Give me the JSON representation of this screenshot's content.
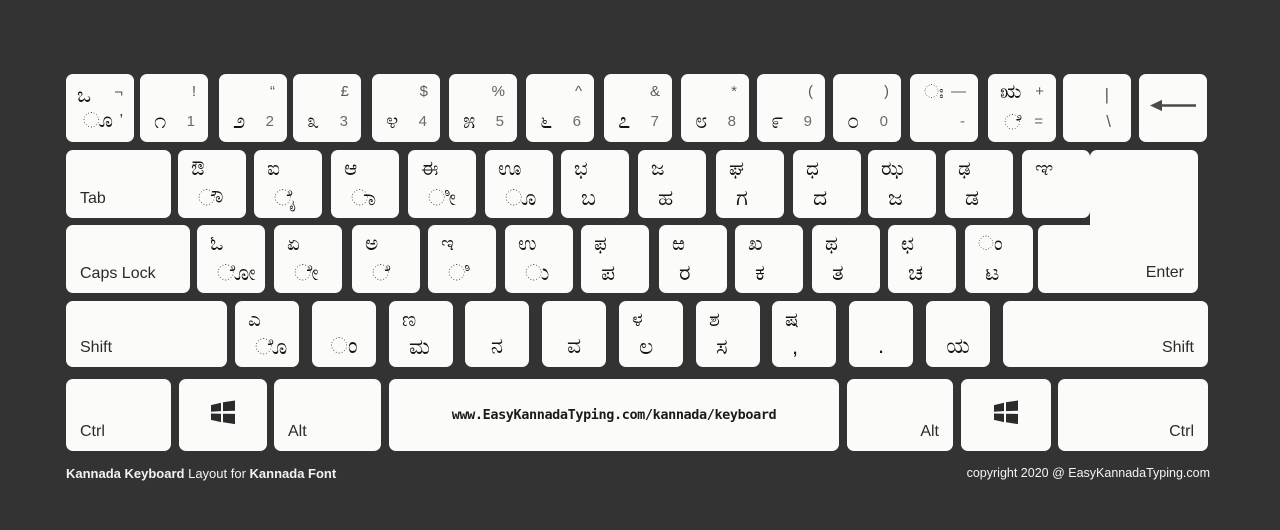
{
  "page": {
    "background_color": "#333333",
    "key_color": "#fbfbf9",
    "key_text_color": "#1c1c1c",
    "symbol_text_color": "#5c5c5c"
  },
  "footer": {
    "left_bold_1": "Kannada Keyboard",
    "left_regular": " Layout for ",
    "left_bold_2": "Kannada Font",
    "right": "copyright 2020 @ EasyKannadaTyping.com"
  },
  "spacebar": {
    "url": "www.EasyKannadaTyping.com/kannada/keyboard"
  },
  "rows": {
    "number_row": [
      {
        "name": "backquote",
        "tl": "ಒ",
        "tr": "¬",
        "bl": "ೂ",
        "br": "’"
      },
      {
        "name": "digit-1",
        "symbol": "!",
        "kannada": "೧",
        "digit": "1"
      },
      {
        "name": "digit-2",
        "symbol": "“",
        "kannada": "೨",
        "digit": "2"
      },
      {
        "name": "digit-3",
        "symbol": "£",
        "kannada": "೩",
        "digit": "3"
      },
      {
        "name": "digit-4",
        "symbol": "$",
        "kannada": "೪",
        "digit": "4"
      },
      {
        "name": "digit-5",
        "symbol": "%",
        "kannada": "೫",
        "digit": "5"
      },
      {
        "name": "digit-6",
        "symbol": "^",
        "kannada": "೬",
        "digit": "6"
      },
      {
        "name": "digit-7",
        "symbol": "&",
        "kannada": "೭",
        "digit": "7"
      },
      {
        "name": "digit-8",
        "symbol": "*",
        "kannada": "೮",
        "digit": "8"
      },
      {
        "name": "digit-9",
        "symbol": "(",
        "kannada": "೯",
        "digit": "9"
      },
      {
        "name": "digit-0",
        "symbol": ")",
        "kannada": "೦",
        "digit": "0"
      },
      {
        "name": "minus",
        "upper": "ಃ",
        "upper_sym": "—",
        "lower_sym": "-"
      },
      {
        "name": "equal",
        "upper": "ಋ",
        "upper_sym": "+",
        "lower": "ೆ",
        "lower_sym": "="
      },
      {
        "name": "backslash",
        "pipe": "|",
        "backslash": "\\"
      },
      {
        "name": "backspace",
        "icon": "backspace-arrow-icon"
      }
    ],
    "tab_row": {
      "tab_label": "Tab",
      "keys": [
        {
          "name": "key-q",
          "upper": "ಔ",
          "lower": "ೌ"
        },
        {
          "name": "key-w",
          "upper": "ಐ",
          "lower": "ೈ"
        },
        {
          "name": "key-e",
          "upper": "ಆ",
          "lower": "ಾ"
        },
        {
          "name": "key-r",
          "upper": "ಈ",
          "lower": "ೀ"
        },
        {
          "name": "key-t",
          "upper": "ಊ",
          "lower": "ೂ"
        },
        {
          "name": "key-y",
          "upper": "ಭ",
          "lower": "ಬ"
        },
        {
          "name": "key-u",
          "upper": "ಜ",
          "lower": "ಹ"
        },
        {
          "name": "key-i",
          "upper": "ಘ",
          "lower": "ಗ"
        },
        {
          "name": "key-o",
          "upper": "ಧ",
          "lower": "ದ"
        },
        {
          "name": "key-p",
          "upper": "ಝ",
          "lower": "ಜ"
        },
        {
          "name": "key-bracketleft",
          "upper": "ಢ",
          "lower": "ಡ"
        },
        {
          "name": "key-bracketright",
          "upper": "ಞ"
        }
      ]
    },
    "caps_row": {
      "caps_label": "Caps Lock",
      "enter_label": "Enter",
      "keys": [
        {
          "name": "key-a",
          "upper": "ಓ",
          "lower": "ೋ"
        },
        {
          "name": "key-s",
          "upper": "ಏ",
          "lower": "ೇ"
        },
        {
          "name": "key-d",
          "upper": "ಅ",
          "lower": "ೆ"
        },
        {
          "name": "key-f",
          "upper": "ಇ",
          "lower": "ಿ"
        },
        {
          "name": "key-g",
          "upper": "ಉ",
          "lower": "ು"
        },
        {
          "name": "key-h",
          "upper": "ಫ",
          "lower": "ಪ"
        },
        {
          "name": "key-j",
          "upper": "ಱ",
          "lower": "ರ"
        },
        {
          "name": "key-k",
          "upper": "ಖ",
          "lower": "ಕ"
        },
        {
          "name": "key-l",
          "upper": "ಥ",
          "lower": "ತ"
        },
        {
          "name": "key-semicolon",
          "upper": "ಛ",
          "lower": "ಚ"
        },
        {
          "name": "key-quote",
          "upper": "ಂ",
          "lower": "ಟ"
        }
      ]
    },
    "shift_row": {
      "shift_left_label": "Shift",
      "shift_right_label": "Shift",
      "keys": [
        {
          "name": "key-z",
          "upper": "ಎ",
          "lower": "ೊ"
        },
        {
          "name": "key-x",
          "lower_only": "ಂ"
        },
        {
          "name": "key-c",
          "upper": "ಣ",
          "lower": "ಮ"
        },
        {
          "name": "key-v",
          "lower_only": "ನ"
        },
        {
          "name": "key-b",
          "lower_only": "ವ"
        },
        {
          "name": "key-n",
          "upper": "ಳ",
          "lower": "ಲ"
        },
        {
          "name": "key-m",
          "upper": "ಶ",
          "lower": "ಸ"
        },
        {
          "name": "key-comma",
          "upper": "ಷ",
          "lower": ","
        },
        {
          "name": "key-period",
          "lower_only": "."
        },
        {
          "name": "key-slash",
          "lower_only": "ಯ"
        }
      ]
    },
    "bottom_row": [
      {
        "name": "ctrl-left",
        "label": "Ctrl",
        "align": "left"
      },
      {
        "name": "win-left",
        "icon": "windows-logo-icon"
      },
      {
        "name": "alt-left",
        "label": "Alt",
        "align": "left"
      },
      {
        "name": "spacebar",
        "icon": "spacebar"
      },
      {
        "name": "alt-right",
        "label": "Alt",
        "align": "right"
      },
      {
        "name": "win-right",
        "icon": "windows-logo-icon"
      },
      {
        "name": "ctrl-right",
        "label": "Ctrl",
        "align": "right"
      }
    ]
  }
}
